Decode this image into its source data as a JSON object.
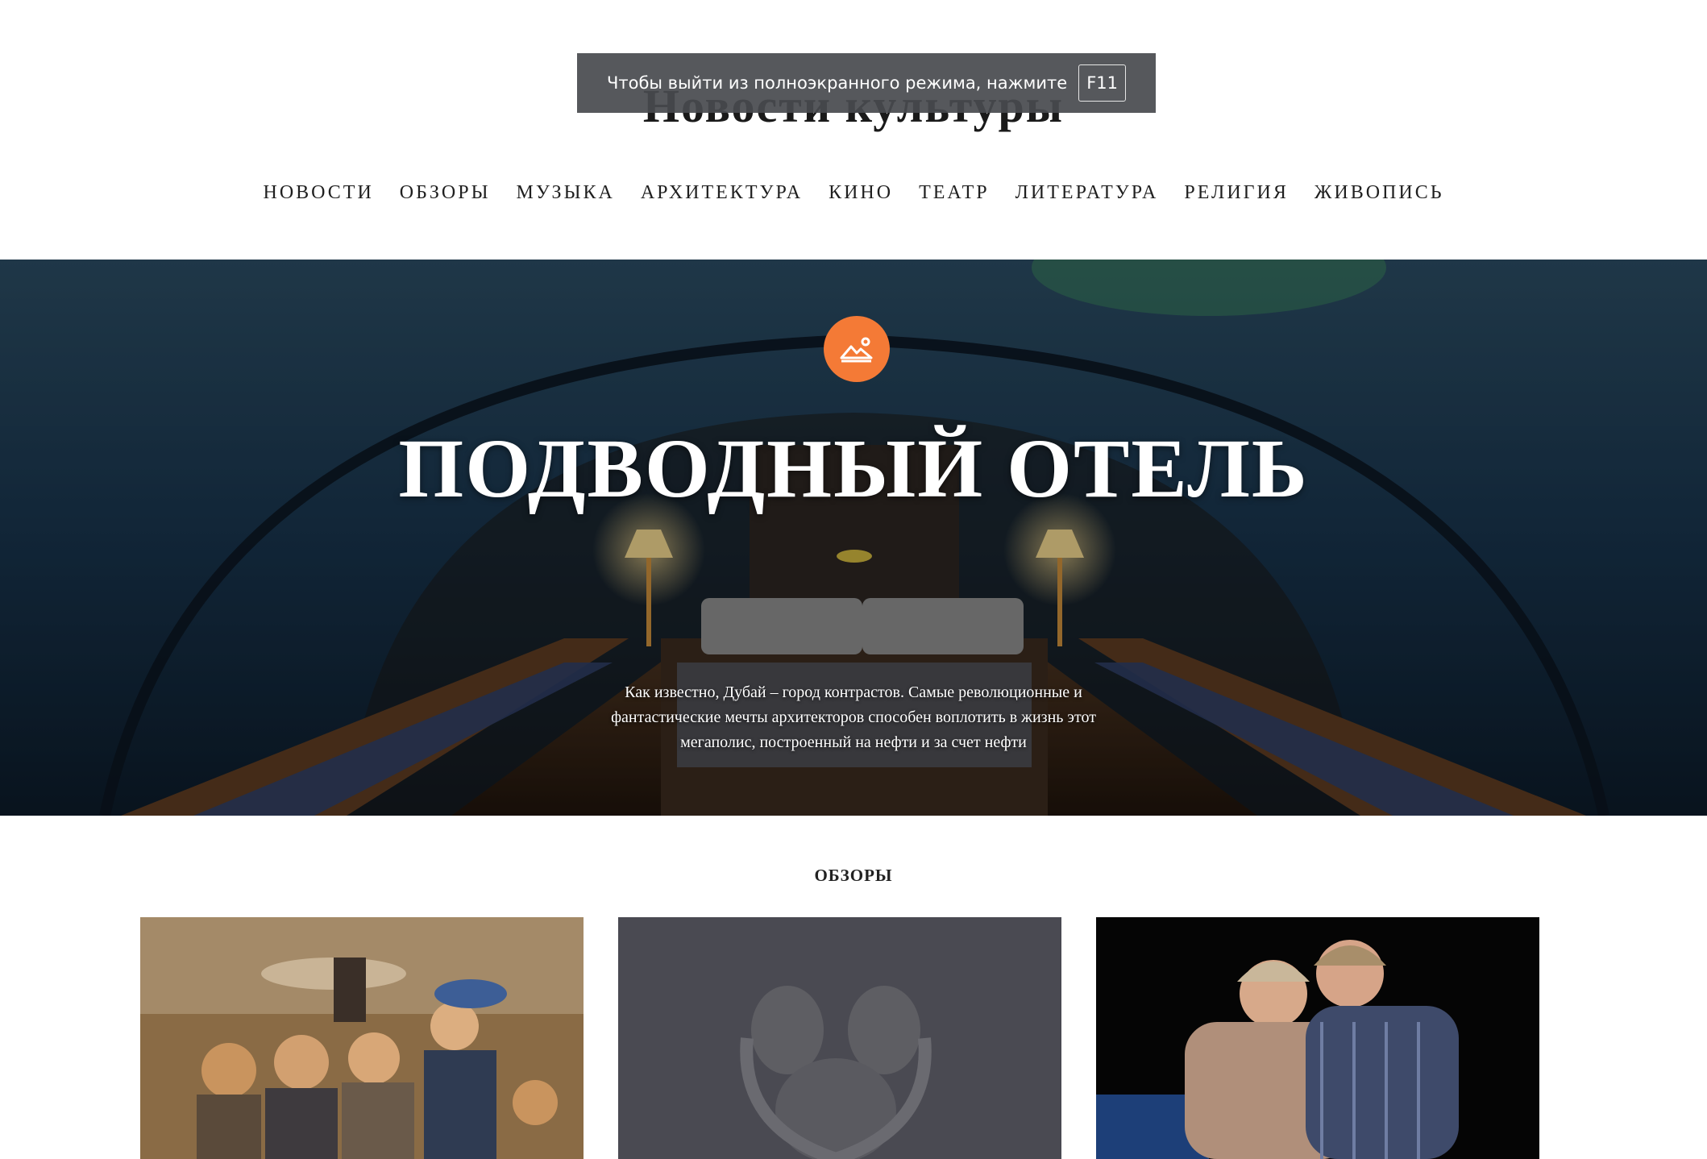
{
  "site": {
    "title": "Новости культуры"
  },
  "fullscreen_toast": {
    "message": "Чтобы выйти из полноэкранного режима, нажмите",
    "key": "F11"
  },
  "nav": {
    "items": [
      {
        "label": "НОВОСТИ"
      },
      {
        "label": "ОБЗОРЫ"
      },
      {
        "label": "МУЗЫКА"
      },
      {
        "label": "АРХИТЕКТУРА"
      },
      {
        "label": "КИНО"
      },
      {
        "label": "ТЕАТР"
      },
      {
        "label": "ЛИТЕРАТУРА"
      },
      {
        "label": "РЕЛИГИЯ"
      },
      {
        "label": "ЖИВОПИСЬ"
      }
    ]
  },
  "hero": {
    "badge_icon": "image-icon",
    "title": "ПОДВОДНЫЙ ОТЕЛЬ",
    "lead": "Как известно, Дубай – город контрастов. Самые революционные и фантастические мечты архитекторов способен воплотить в жизнь этот мегаполис, построенный на нефти и за счет нефти"
  },
  "section": {
    "heading": "ОБЗОРЫ"
  },
  "colors": {
    "accent": "#f47a36",
    "toast_bg": "#484a4e"
  }
}
